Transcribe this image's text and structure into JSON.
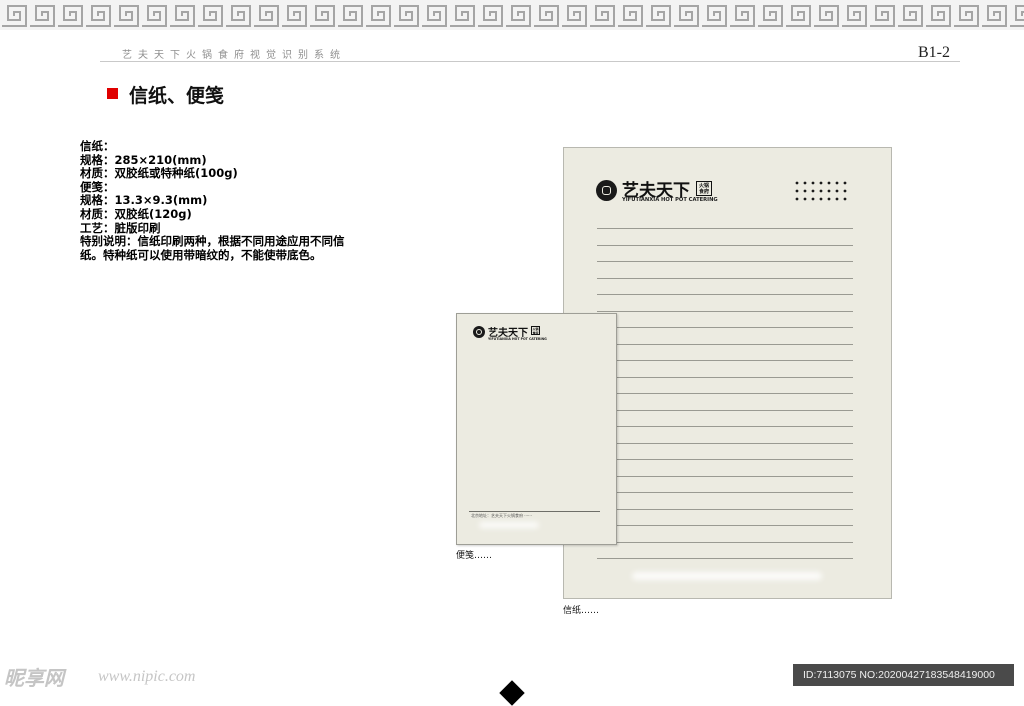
{
  "header": {
    "system_title": "艺夫天下火锅食府视觉识别系统",
    "page_code": "B1-2"
  },
  "section": {
    "title": "信纸、便笺"
  },
  "specs": {
    "lines": [
      "信纸：",
      "规格：285×210(mm)",
      "材质：双胶纸或特种纸(100g)",
      "便笺：",
      "规格：13.3×9.3(mm)",
      "材质：双胶纸(120g)",
      "工艺：脏版印刷"
    ],
    "note": "特别说明：信纸印刷两种，根据不同用途应用不同信纸。特种纸可以使用带暗纹的，不能使带底色。"
  },
  "brand": {
    "name_cn": "艺夫天下",
    "name_en": "YIFUTIANXIA HOT POT CATERING",
    "seal": "火锅食府"
  },
  "memo": {
    "footer_text": "北京地址：艺夫天下火锅食府 ······",
    "caption": "便笺……"
  },
  "letterhead": {
    "caption": "信纸……"
  },
  "watermark": {
    "logo": "昵享网",
    "url": "www.nipic.com",
    "id_text": "ID:7113075 NO:20200427183548419000"
  },
  "colors": {
    "accent_red": "#e00000",
    "paper": "#ecebe1",
    "ink": "#111111"
  }
}
